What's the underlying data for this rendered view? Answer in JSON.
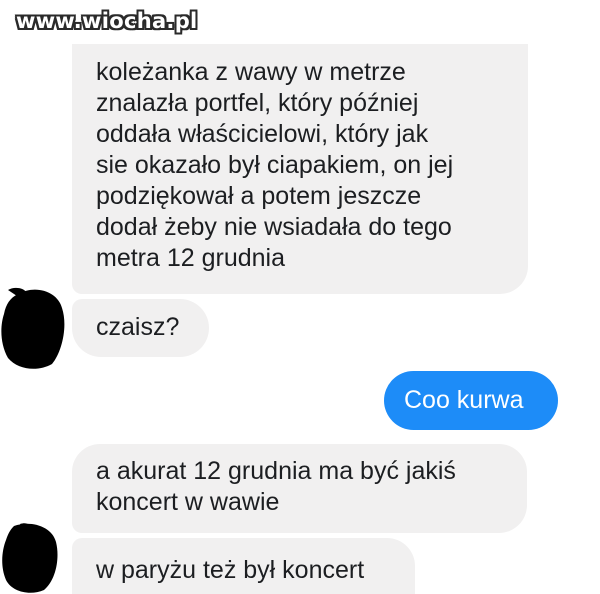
{
  "watermark": "www.wiocha.pl",
  "colors": {
    "incoming_bubble": "#f1f0f0",
    "outgoing_bubble": "#1d8cf8",
    "redaction": "#000000"
  },
  "messages": [
    {
      "direction": "incoming",
      "text": "koleżanka z wawy w metrze\nznalazła portfel, który później\noddała właścicielowi, który jak\nsie okazało był ciapakiem, on jej\npodziękował a potem jeszcze\ndodał żeby nie wsiadała do tego\nmetra 12 grudnia"
    },
    {
      "direction": "incoming",
      "text": "czaisz?",
      "avatar": "redacted"
    },
    {
      "direction": "outgoing",
      "text": "Coo kurwa"
    },
    {
      "direction": "incoming",
      "text": "a akurat 12 grudnia ma być jakiś\nkoncert w wawie"
    },
    {
      "direction": "incoming",
      "text": "w paryżu też był koncert",
      "avatar": "redacted"
    }
  ]
}
